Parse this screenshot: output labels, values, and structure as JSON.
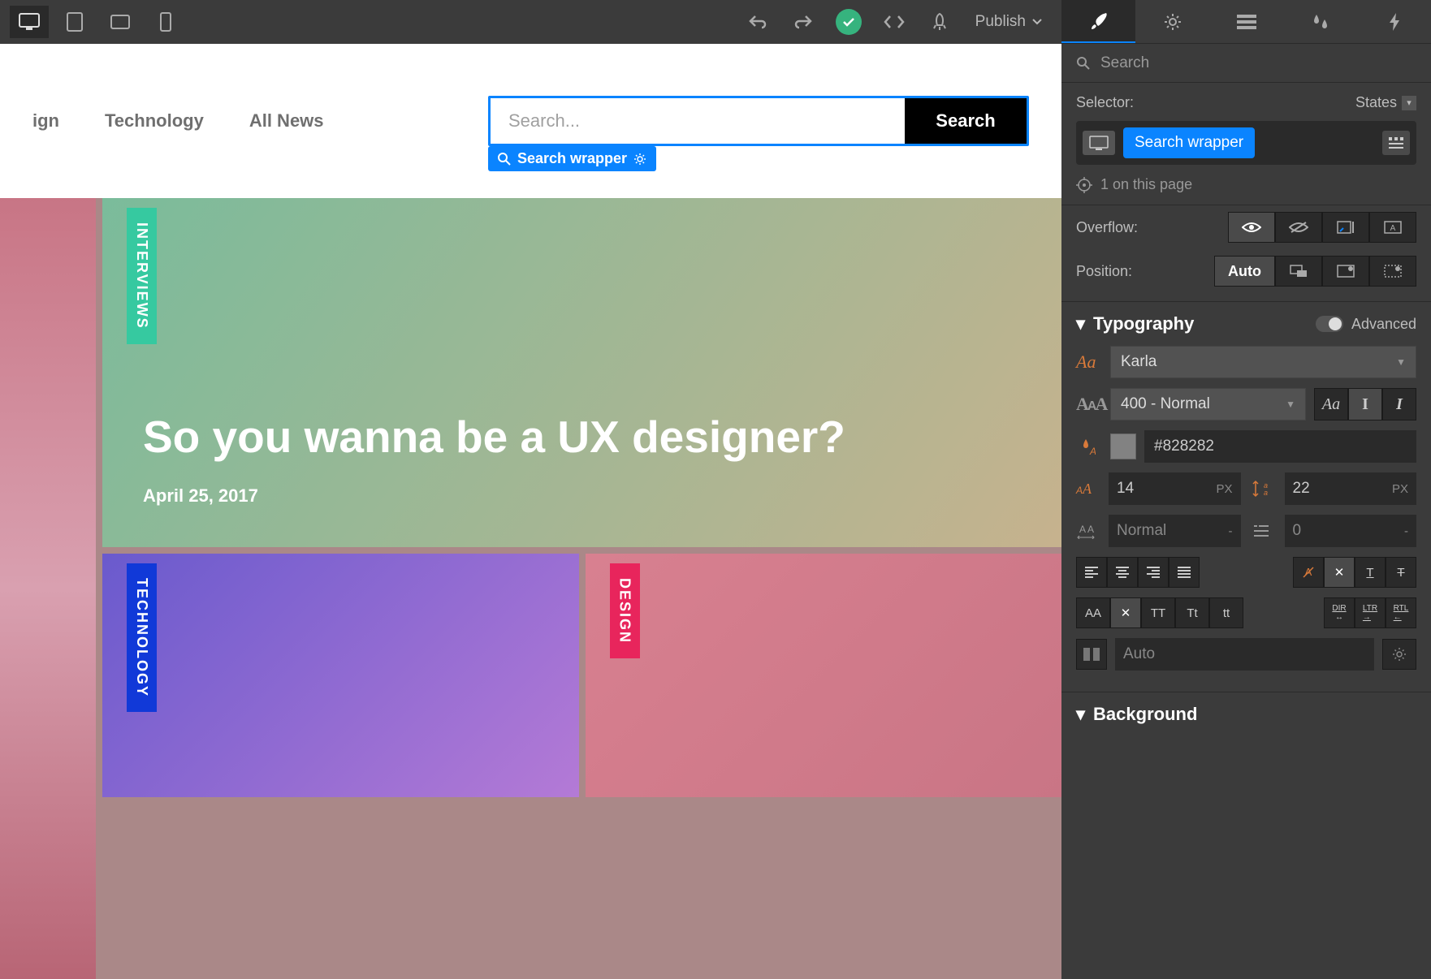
{
  "toolbar": {
    "publish_label": "Publish"
  },
  "nav": {
    "items": [
      "ign",
      "Technology",
      "All News"
    ]
  },
  "search": {
    "placeholder": "Search...",
    "button_label": "Search",
    "selection_label": "Search wrapper"
  },
  "hero": {
    "tag": "INTERVIEWS",
    "title": "So you wanna be a UX designer?",
    "date": "April 25, 2017"
  },
  "cards": {
    "tech_tag": "TECHNOLOGY",
    "design_tag": "DESIGN"
  },
  "panel": {
    "search_placeholder": "Search",
    "selector_label": "Selector:",
    "states_label": "States",
    "selected_chip": "Search wrapper",
    "page_count": "1 on this page",
    "overflow_label": "Overflow:",
    "position_label": "Position:",
    "position_value": "Auto",
    "typography_title": "Typography",
    "advanced_label": "Advanced",
    "font_family": "Karla",
    "font_weight": "400 - Normal",
    "font_color": "#828282",
    "font_size": "14",
    "font_size_unit": "PX",
    "line_height": "22",
    "line_height_unit": "PX",
    "letter_spacing": "Normal",
    "letter_spacing_unit": "-",
    "indent": "0",
    "indent_unit": "-",
    "column_value": "Auto",
    "background_title": "Background"
  }
}
